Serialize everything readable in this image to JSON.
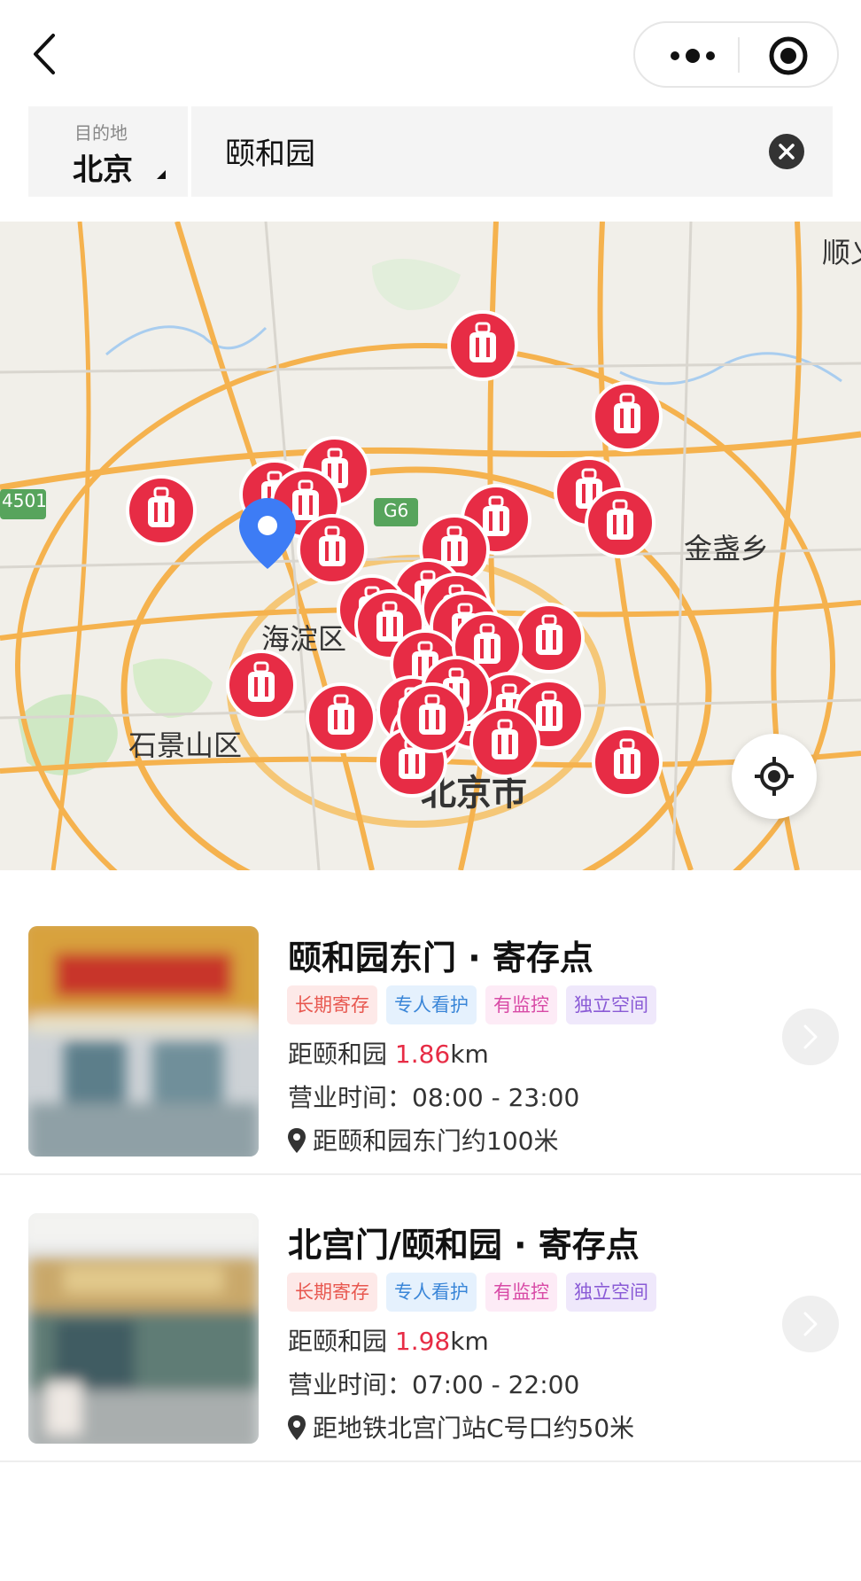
{
  "header": {
    "back_icon": "chevron-left-icon",
    "more_icon": "more-dots-icon",
    "close_icon": "target-circle-icon"
  },
  "search": {
    "destination_caption": "目的地",
    "destination_city": "北京",
    "query": "颐和园",
    "clear_icon": "clear-icon"
  },
  "map": {
    "labels": {
      "shunyi": "顺义",
      "jinzhan": "金盏乡",
      "haidian": "海淀区",
      "shijingshan": "石景山区",
      "beijingshi": "北京市",
      "road_g6": "G6",
      "road_4501": "4501"
    },
    "marker_icon": "luggage-icon",
    "current_location_icon": "location-pin-icon",
    "locate_icon": "locate-crosshair-icon",
    "colors": {
      "marker": "#e72c45",
      "current_pin": "#3d7cf5",
      "road": "#f5b24e"
    }
  },
  "results": [
    {
      "title": "颐和园东门 · 寄存点",
      "tags": [
        {
          "label": "长期寄存",
          "color": "#e8574f",
          "bg": "#fde9e8"
        },
        {
          "label": "专人看护",
          "color": "#3a86d8",
          "bg": "#e5f1fd"
        },
        {
          "label": "有监控",
          "color": "#d84aa6",
          "bg": "#fdebf6"
        },
        {
          "label": "独立空间",
          "color": "#8a5bd6",
          "bg": "#efe8fb"
        }
      ],
      "distance_prefix": "距颐和园 ",
      "distance_value": "1.86",
      "distance_unit": "km",
      "hours": "营业时间：08:00 - 23:00",
      "location": "距颐和园东门约100米"
    },
    {
      "title": "北宫门/颐和园 · 寄存点",
      "tags": [
        {
          "label": "长期寄存",
          "color": "#e8574f",
          "bg": "#fde9e8"
        },
        {
          "label": "专人看护",
          "color": "#3a86d8",
          "bg": "#e5f1fd"
        },
        {
          "label": "有监控",
          "color": "#d84aa6",
          "bg": "#fdebf6"
        },
        {
          "label": "独立空间",
          "color": "#8a5bd6",
          "bg": "#efe8fb"
        }
      ],
      "distance_prefix": "距颐和园 ",
      "distance_value": "1.98",
      "distance_unit": "km",
      "hours": "营业时间：07:00 - 22:00",
      "location": "距地铁北宫门站C号口约50米"
    }
  ]
}
